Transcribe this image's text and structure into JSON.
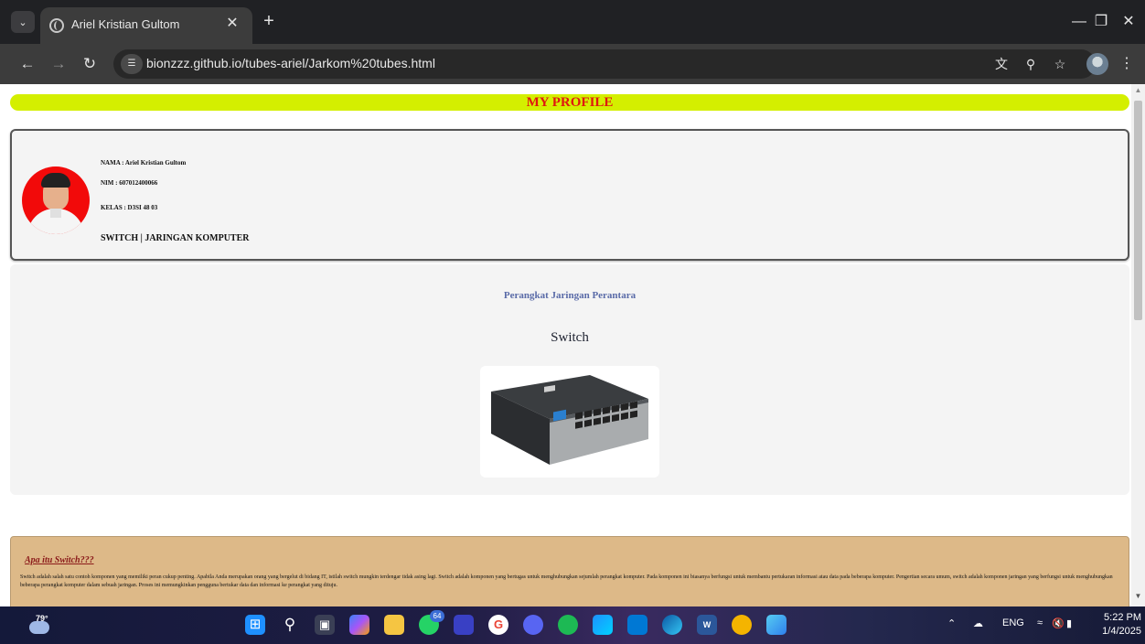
{
  "browser": {
    "tab_title": "Ariel Kristian Gultom",
    "url": "bionzzz.github.io/tubes-ariel/Jarkom%20tubes.html",
    "icons": [
      "tab-search-icon",
      "globe-icon",
      "close-icon",
      "plus-icon",
      "minimize-icon",
      "restore-icon",
      "back-icon",
      "forward-icon",
      "reload-icon",
      "site-info-icon",
      "translate-icon",
      "zoom-icon",
      "star-icon",
      "profile-icon",
      "more-vert-icon"
    ]
  },
  "page": {
    "banner": "MY PROFILE",
    "profile": {
      "nama": "NAMA : Ariel Kristian Gultom",
      "nim": "NIM : 607012400066",
      "kelas": "KELAS : D3SI 48 03",
      "topic": "SWITCH | JARINGAN KOMPUTER"
    },
    "section_title": "Perangkat Jaringan Perantara",
    "device_heading": "Switch",
    "about": {
      "title": "Apa itu Switch???",
      "text": "Switch adalah salah satu contoh komponen yang memiliki peran cukup penting. Apabila Anda merupakan orang yang bergelut di bidang IT, istilah switch mungkin terdengar tidak asing lagi. Switch adalah komponen yang bertugas untuk menghubungkan sejumlah perangkat komputer. Pada komponen ini biasanya berfungsi untuk membantu pertukaran informasi atau data pada beberapa komputer. Pengertian secara umum, switch adalah komponen jaringan yang berfungsi untuk menghubungkan beberapa perangkat komputer dalam sebuah jaringan. Proses ini memungkinkan pengguna bertukar data dan informasi ke perangkat yang dituju."
    }
  },
  "taskbar": {
    "weather_temp": "79°",
    "whatsapp_badge": "64",
    "language": "ENG",
    "time": "5:22 PM",
    "date": "1/4/2025"
  },
  "colors": {
    "banner_bg": "#d4ef00",
    "banner_text": "#e0180f",
    "about_bg": "#ddb988",
    "section_title": "#5a6ba8"
  }
}
